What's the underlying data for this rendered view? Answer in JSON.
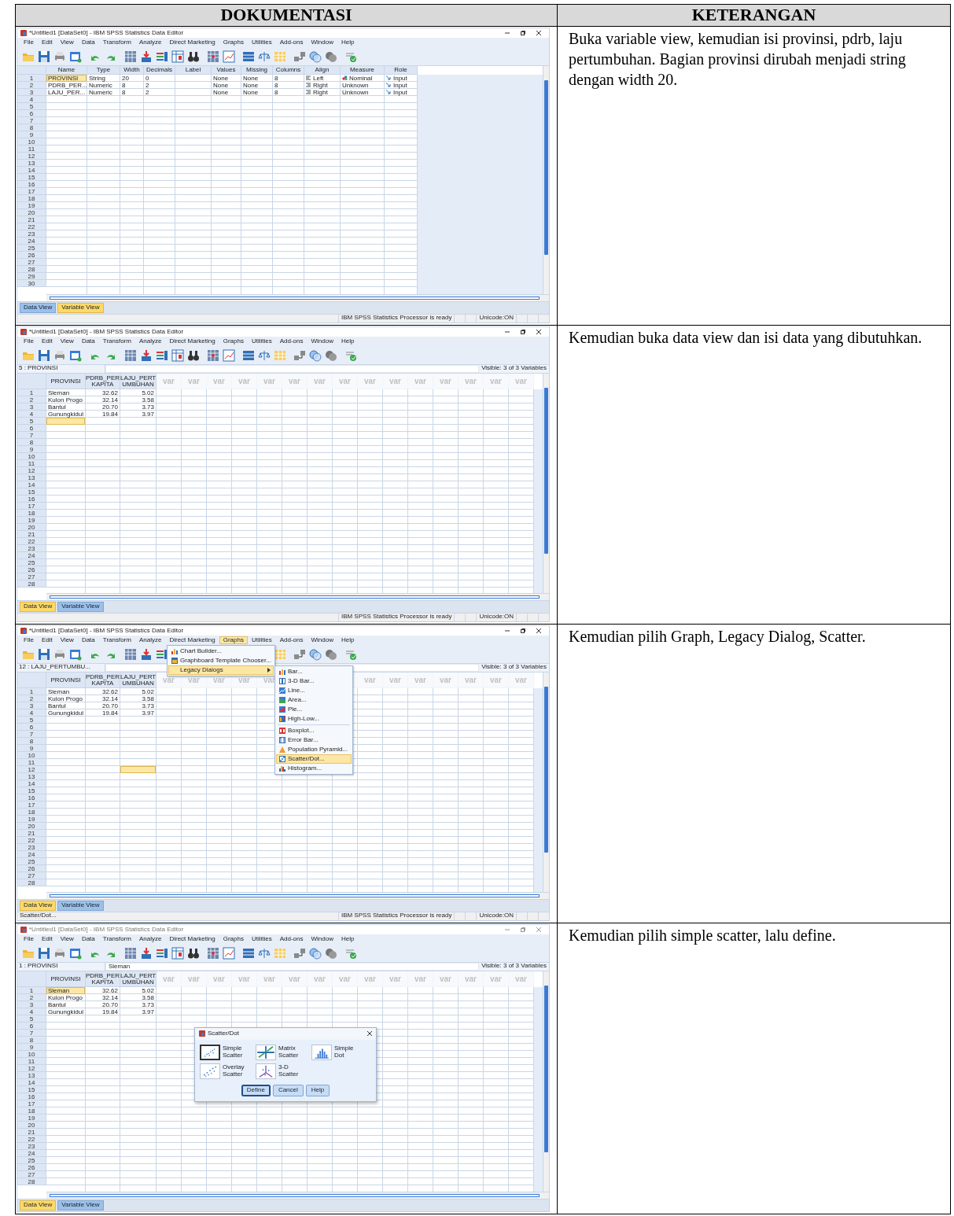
{
  "header": {
    "column_1": "DOKUMENTASI",
    "column_2": "KETERANGAN"
  },
  "steps": [
    {
      "description": "Buka variable view, kemudian isi provinsi, pdrb, laju pertumbuhan. Bagian provinsi dirubah menjadi string dengan width 20.",
      "window": {
        "title": "*Untitled1 [DataSet0] - IBM SPSS Statistics Data Editor",
        "active": true,
        "menu": [
          {
            "label": "File",
            "selected": false
          },
          {
            "label": "Edit",
            "selected": false
          },
          {
            "label": "View",
            "selected": false
          },
          {
            "label": "Data",
            "selected": false
          },
          {
            "label": "Transform",
            "selected": false
          },
          {
            "label": "Analyze",
            "selected": false
          },
          {
            "label": "Direct Marketing",
            "selected": false
          },
          {
            "label": "Graphs",
            "selected": false
          },
          {
            "label": "Utilities",
            "selected": false
          },
          {
            "label": "Add-ons",
            "selected": false
          },
          {
            "label": "Window",
            "selected": false
          },
          {
            "label": "Help",
            "selected": false
          }
        ],
        "grid": {
          "columns": [
            {
              "label": "Name",
              "kind": "property"
            },
            {
              "label": "Type",
              "kind": "property"
            },
            {
              "label": "Width",
              "kind": "property"
            },
            {
              "label": "Decimals",
              "kind": "property"
            },
            {
              "label": "Label",
              "kind": "property"
            },
            {
              "label": "Values",
              "kind": "property"
            },
            {
              "label": "Missing",
              "kind": "property"
            },
            {
              "label": "Columns",
              "kind": "property"
            },
            {
              "label": "Align",
              "kind": "property"
            },
            {
              "label": "Measure",
              "kind": "property"
            },
            {
              "label": "Role",
              "kind": "property"
            }
          ],
          "rows": [
            {
              "number": "1",
              "cells": [
                {
                  "text": "PROVINSI",
                  "selected": true
                },
                {
                  "text": "String",
                  "selected": false
                },
                {
                  "text": "20",
                  "selected": false
                },
                {
                  "text": "0",
                  "selected": false
                },
                {
                  "selected": false
                },
                {
                  "text": "None",
                  "selected": false
                },
                {
                  "text": "None",
                  "selected": false
                },
                {
                  "text": "8",
                  "selected": false
                },
                {
                  "text": "Left",
                  "selected": false,
                  "kind": "left"
                },
                {
                  "text": "Nominal",
                  "selected": false,
                  "kind": "nominal"
                },
                {
                  "text": "Input",
                  "selected": false,
                  "kind": "role"
                }
              ]
            },
            {
              "number": "2",
              "cells": [
                {
                  "text": "PDRB_PER...",
                  "selected": false
                },
                {
                  "text": "Numeric",
                  "selected": false
                },
                {
                  "text": "8",
                  "selected": false
                },
                {
                  "text": "2",
                  "selected": false
                },
                {
                  "selected": false
                },
                {
                  "text": "None",
                  "selected": false
                },
                {
                  "text": "None",
                  "selected": false
                },
                {
                  "text": "8",
                  "selected": false
                },
                {
                  "text": "Right",
                  "selected": false,
                  "kind": "right"
                },
                {
                  "text": "Unknown",
                  "selected": false
                },
                {
                  "text": "Input",
                  "selected": false,
                  "kind": "role"
                }
              ]
            },
            {
              "number": "3",
              "cells": [
                {
                  "text": "LAJU_PER...",
                  "selected": false
                },
                {
                  "text": "Numeric",
                  "selected": false
                },
                {
                  "text": "8",
                  "selected": false
                },
                {
                  "text": "2",
                  "selected": false
                },
                {
                  "selected": false
                },
                {
                  "text": "None",
                  "selected": false
                },
                {
                  "text": "None",
                  "selected": false
                },
                {
                  "text": "8",
                  "selected": false
                },
                {
                  "text": "Right",
                  "selected": false,
                  "kind": "right"
                },
                {
                  "text": "Unknown",
                  "selected": false
                },
                {
                  "text": "Input",
                  "selected": false,
                  "kind": "role"
                }
              ]
            },
            {
              "number": "4"
            },
            {
              "number": "5"
            },
            {
              "number": "6"
            },
            {
              "number": "7"
            },
            {
              "number": "8"
            },
            {
              "number": "9"
            },
            {
              "number": "10"
            },
            {
              "number": "11"
            },
            {
              "number": "12"
            },
            {
              "number": "13"
            },
            {
              "number": "14"
            },
            {
              "number": "15"
            },
            {
              "number": "16"
            },
            {
              "number": "17"
            },
            {
              "number": "18"
            },
            {
              "number": "19"
            },
            {
              "number": "20"
            },
            {
              "number": "21"
            },
            {
              "number": "22"
            },
            {
              "number": "23"
            },
            {
              "number": "24"
            },
            {
              "number": "25"
            },
            {
              "number": "26"
            },
            {
              "number": "27"
            },
            {
              "number": "28"
            },
            {
              "number": "29"
            },
            {
              "number": "30"
            }
          ]
        },
        "tabs": [
          {
            "label": "Data View",
            "selected": false
          },
          {
            "label": "Variable View",
            "selected": true
          }
        ],
        "status": {
          "processor": "IBM SPSS Statistics Processor is ready",
          "unicode": "Unicode:ON"
        }
      }
    },
    {
      "description": "Kemudian buka data view dan isi data yang dibutuhkan.",
      "window": {
        "title": "*Untitled1 [DataSet0] - IBM SPSS Statistics Data Editor",
        "active": true,
        "menu": [
          {
            "label": "File",
            "selected": false
          },
          {
            "label": "Edit",
            "selected": false
          },
          {
            "label": "View",
            "selected": false
          },
          {
            "label": "Data",
            "selected": false
          },
          {
            "label": "Transform",
            "selected": false
          },
          {
            "label": "Analyze",
            "selected": false
          },
          {
            "label": "Direct Marketing",
            "selected": false
          },
          {
            "label": "Graphs",
            "selected": false
          },
          {
            "label": "Utilities",
            "selected": false
          },
          {
            "label": "Add-ons",
            "selected": false
          },
          {
            "label": "Window",
            "selected": false
          },
          {
            "label": "Help",
            "selected": false
          }
        ],
        "cell_editor": {
          "reference": "5 : PROVINSI"
        },
        "visible_label": "Visible: 3 of 3 Variables",
        "grid": {
          "columns": [
            {
              "label": "PROVINSI",
              "kind": "string"
            },
            {
              "label": "PDRB_PER KAPITA",
              "kind": "numeric"
            },
            {
              "label": "LAJU_PERT UMBUHAN",
              "kind": "numeric"
            },
            {
              "label": "var",
              "kind": "empty"
            },
            {
              "label": "var",
              "kind": "empty"
            },
            {
              "label": "var",
              "kind": "empty"
            },
            {
              "label": "var",
              "kind": "empty"
            },
            {
              "label": "var",
              "kind": "empty"
            },
            {
              "label": "var",
              "kind": "empty"
            },
            {
              "label": "var",
              "kind": "empty"
            },
            {
              "label": "var",
              "kind": "empty"
            },
            {
              "label": "var",
              "kind": "empty"
            },
            {
              "label": "var",
              "kind": "empty"
            },
            {
              "label": "var",
              "kind": "empty"
            },
            {
              "label": "var",
              "kind": "empty"
            },
            {
              "label": "var",
              "kind": "empty"
            },
            {
              "label": "var",
              "kind": "empty"
            },
            {
              "label": "var",
              "kind": "empty"
            }
          ],
          "rows": [
            {
              "number": "1",
              "cells": [
                {
                  "text": "Sleman",
                  "selected": false
                },
                {
                  "text": "32.62",
                  "selected": false
                },
                {
                  "text": "5.02",
                  "selected": false
                }
              ]
            },
            {
              "number": "2",
              "cells": [
                {
                  "text": "Kulon Progo",
                  "selected": false
                },
                {
                  "text": "32.14",
                  "selected": false
                },
                {
                  "text": "3.58",
                  "selected": false
                }
              ]
            },
            {
              "number": "3",
              "cells": [
                {
                  "text": "Bantul",
                  "selected": false
                },
                {
                  "text": "20.70",
                  "selected": false
                },
                {
                  "text": "3.73",
                  "selected": false
                }
              ]
            },
            {
              "number": "4",
              "cells": [
                {
                  "text": "Gunungkidul",
                  "selected": false
                },
                {
                  "text": "19.84",
                  "selected": false
                },
                {
                  "text": "3.97",
                  "selected": false
                }
              ]
            },
            {
              "number": "5",
              "cells": [
                {
                  "selected": true
                }
              ]
            },
            {
              "number": "6"
            },
            {
              "number": "7"
            },
            {
              "number": "8"
            },
            {
              "number": "9"
            },
            {
              "number": "10"
            },
            {
              "number": "11"
            },
            {
              "number": "12"
            },
            {
              "number": "13"
            },
            {
              "number": "14"
            },
            {
              "number": "15"
            },
            {
              "number": "16"
            },
            {
              "number": "17"
            },
            {
              "number": "18"
            },
            {
              "number": "19"
            },
            {
              "number": "20"
            },
            {
              "number": "21"
            },
            {
              "number": "22"
            },
            {
              "number": "23"
            },
            {
              "number": "24"
            },
            {
              "number": "25"
            },
            {
              "number": "26"
            },
            {
              "number": "27"
            },
            {
              "number": "28"
            }
          ]
        },
        "tabs": [
          {
            "label": "Data View",
            "selected": true
          },
          {
            "label": "Variable View",
            "selected": false
          }
        ],
        "status": {
          "processor": "IBM SPSS Statistics Processor is ready",
          "unicode": "Unicode:ON"
        }
      }
    },
    {
      "description": "Kemudian pilih Graph, Legacy Dialog, Scatter.",
      "window": {
        "title": "*Untitled1 [DataSet0] - IBM SPSS Statistics Data Editor",
        "active": true,
        "menu": [
          {
            "label": "File",
            "selected": false
          },
          {
            "label": "Edit",
            "selected": false
          },
          {
            "label": "View",
            "selected": false
          },
          {
            "label": "Data",
            "selected": false
          },
          {
            "label": "Transform",
            "selected": false
          },
          {
            "label": "Analyze",
            "selected": false
          },
          {
            "label": "Direct Marketing",
            "selected": false
          },
          {
            "label": "Graphs",
            "selected": true
          },
          {
            "label": "Utilities",
            "selected": false
          },
          {
            "label": "Add-ons",
            "selected": false
          },
          {
            "label": "Window",
            "selected": false
          },
          {
            "label": "Help",
            "selected": false
          }
        ],
        "dropdown": [
          {
            "label": "Chart Builder...",
            "kind": "builder",
            "selected": false,
            "submenu": false
          },
          {
            "label": "Graphboard Template Chooser...",
            "kind": "graphboard",
            "selected": false,
            "submenu": false
          },
          {
            "label": "Legacy Dialogs",
            "kind": "legacy",
            "selected": true,
            "submenu": true
          }
        ],
        "submenu": [
          {
            "kind": "bar",
            "label": "Bar...",
            "selected": false
          },
          {
            "kind": "bar3d",
            "label": "3-D Bar...",
            "selected": false
          },
          {
            "kind": "line",
            "label": "Line...",
            "selected": false
          },
          {
            "kind": "area",
            "label": "Area...",
            "selected": false
          },
          {
            "kind": "pie",
            "label": "Pie...",
            "selected": false
          },
          {
            "kind": "highlow",
            "label": "High-Low...",
            "selected": false
          },
          {
            "kind": "separator"
          },
          {
            "kind": "boxplot",
            "label": "Boxplot...",
            "selected": false
          },
          {
            "kind": "errorbar",
            "label": "Error Bar...",
            "selected": false
          },
          {
            "kind": "pyramid",
            "label": "Population Pyramid...",
            "selected": false
          },
          {
            "kind": "scatter",
            "label": "Scatter/Dot...",
            "selected": true
          },
          {
            "kind": "histogram",
            "label": "Histogram...",
            "selected": false
          }
        ],
        "cell_editor": {
          "reference": "12 : LAJU_PERTUMBU..."
        },
        "visible_label": "Visible: 3 of 3 Variables",
        "grid": {
          "columns": [
            {
              "label": "PROVINSI",
              "kind": "string"
            },
            {
              "label": "PDRB_PER KAPITA",
              "kind": "numeric"
            },
            {
              "label": "LAJU_PERT UMBUHAN",
              "kind": "numeric"
            },
            {
              "label": "var",
              "kind": "empty"
            },
            {
              "label": "var",
              "kind": "empty"
            },
            {
              "label": "var",
              "kind": "empty"
            },
            {
              "label": "var",
              "kind": "empty"
            },
            {
              "label": "var",
              "kind": "empty"
            },
            {
              "kind": "empty"
            },
            {
              "kind": "empty"
            },
            {
              "kind": "empty"
            },
            {
              "label": "var",
              "kind": "empty"
            },
            {
              "label": "var",
              "kind": "empty"
            },
            {
              "label": "var",
              "kind": "empty"
            },
            {
              "label": "var",
              "kind": "empty"
            },
            {
              "label": "var",
              "kind": "empty"
            },
            {
              "label": "var",
              "kind": "empty"
            },
            {
              "label": "var",
              "kind": "empty"
            }
          ],
          "rows": [
            {
              "number": "1",
              "cells": [
                {
                  "text": "Sleman",
                  "selected": false
                },
                {
                  "text": "32.62",
                  "selected": false
                },
                {
                  "text": "5.02",
                  "selected": false
                }
              ]
            },
            {
              "number": "2",
              "cells": [
                {
                  "text": "Kulon Progo",
                  "selected": false
                },
                {
                  "text": "32.14",
                  "selected": false
                },
                {
                  "text": "3.58",
                  "selected": false
                }
              ]
            },
            {
              "number": "3",
              "cells": [
                {
                  "text": "Bantul",
                  "selected": false
                },
                {
                  "text": "20.70",
                  "selected": false
                },
                {
                  "text": "3.73",
                  "selected": false
                }
              ]
            },
            {
              "number": "4",
              "cells": [
                {
                  "text": "Gunungkidul",
                  "selected": false
                },
                {
                  "text": "19.84",
                  "selected": false
                },
                {
                  "text": "3.97",
                  "selected": false
                }
              ]
            },
            {
              "number": "5"
            },
            {
              "number": "6"
            },
            {
              "number": "7"
            },
            {
              "number": "8"
            },
            {
              "number": "9"
            },
            {
              "number": "10"
            },
            {
              "number": "11"
            },
            {
              "number": "12",
              "cells": [
                {
                  "selected": false
                },
                {
                  "selected": false
                },
                {
                  "selected": true
                }
              ]
            },
            {
              "number": "13"
            },
            {
              "number": "14"
            },
            {
              "number": "15"
            },
            {
              "number": "16"
            },
            {
              "number": "17"
            },
            {
              "number": "18"
            },
            {
              "number": "19"
            },
            {
              "number": "20"
            },
            {
              "number": "21"
            },
            {
              "number": "22"
            },
            {
              "number": "23"
            },
            {
              "number": "24"
            },
            {
              "number": "25"
            },
            {
              "number": "26"
            },
            {
              "number": "27"
            },
            {
              "number": "28"
            }
          ]
        },
        "tabs": [
          {
            "label": "Data View",
            "selected": true
          },
          {
            "label": "Variable View",
            "selected": false
          }
        ],
        "status": {
          "message": "Scatter/Dot...",
          "processor": "IBM SPSS Statistics Processor is ready",
          "unicode": "Unicode:ON"
        }
      }
    },
    {
      "description": "Kemudian pilih simple scatter, lalu define.",
      "window": {
        "title": "*Untitled1 [DataSet0] - IBM SPSS Statistics Data Editor",
        "active": false,
        "menu": [
          {
            "label": "File",
            "selected": false
          },
          {
            "label": "Edit",
            "selected": false
          },
          {
            "label": "View",
            "selected": false
          },
          {
            "label": "Data",
            "selected": false
          },
          {
            "label": "Transform",
            "selected": false
          },
          {
            "label": "Analyze",
            "selected": false
          },
          {
            "label": "Direct Marketing",
            "selected": false
          },
          {
            "label": "Graphs",
            "selected": false
          },
          {
            "label": "Utilities",
            "selected": false
          },
          {
            "label": "Add-ons",
            "selected": false
          },
          {
            "label": "Window",
            "selected": false
          },
          {
            "label": "Help",
            "selected": false
          }
        ],
        "cell_editor": {
          "reference": "1 : PROVINSI",
          "value": "Sleman"
        },
        "visible_label": "Visible: 3 of 3 Variables",
        "grid": {
          "columns": [
            {
              "label": "PROVINSI",
              "kind": "string"
            },
            {
              "label": "PDRB_PER KAPITA",
              "kind": "numeric"
            },
            {
              "label": "LAJU_PERT UMBUHAN",
              "kind": "numeric"
            },
            {
              "label": "var",
              "kind": "empty"
            },
            {
              "label": "var",
              "kind": "empty"
            },
            {
              "label": "var",
              "kind": "empty"
            },
            {
              "label": "var",
              "kind": "empty"
            },
            {
              "label": "var",
              "kind": "empty"
            },
            {
              "label": "var",
              "kind": "empty"
            },
            {
              "label": "var",
              "kind": "empty"
            },
            {
              "label": "var",
              "kind": "empty"
            },
            {
              "label": "var",
              "kind": "empty"
            },
            {
              "label": "var",
              "kind": "empty"
            },
            {
              "label": "var",
              "kind": "empty"
            },
            {
              "label": "var",
              "kind": "empty"
            },
            {
              "label": "var",
              "kind": "empty"
            },
            {
              "label": "var",
              "kind": "empty"
            },
            {
              "label": "var",
              "kind": "empty"
            }
          ],
          "rows": [
            {
              "number": "1",
              "cells": [
                {
                  "text": "Sleman",
                  "selected": true
                },
                {
                  "text": "32.62",
                  "selected": false
                },
                {
                  "text": "5.02",
                  "selected": false
                }
              ]
            },
            {
              "number": "2",
              "cells": [
                {
                  "text": "Kulon Progo",
                  "selected": false
                },
                {
                  "text": "32.14",
                  "selected": false
                },
                {
                  "text": "3.58",
                  "selected": false
                }
              ]
            },
            {
              "number": "3",
              "cells": [
                {
                  "text": "Bantul",
                  "selected": false
                },
                {
                  "text": "20.70",
                  "selected": false
                },
                {
                  "text": "3.73",
                  "selected": false
                }
              ]
            },
            {
              "number": "4",
              "cells": [
                {
                  "text": "Gunungkidul",
                  "selected": false
                },
                {
                  "text": "19.84",
                  "selected": false
                },
                {
                  "text": "3.97",
                  "selected": false
                }
              ]
            },
            {
              "number": "5"
            },
            {
              "number": "6"
            },
            {
              "number": "7"
            },
            {
              "number": "8"
            },
            {
              "number": "9"
            },
            {
              "number": "10"
            },
            {
              "number": "11"
            },
            {
              "number": "12"
            },
            {
              "number": "13"
            },
            {
              "number": "14"
            },
            {
              "number": "15"
            },
            {
              "number": "16"
            },
            {
              "number": "17"
            },
            {
              "number": "18"
            },
            {
              "number": "19"
            },
            {
              "number": "20"
            },
            {
              "number": "21"
            },
            {
              "number": "22"
            },
            {
              "number": "23"
            },
            {
              "number": "24"
            },
            {
              "number": "25"
            },
            {
              "number": "26"
            },
            {
              "number": "27"
            },
            {
              "number": "28"
            }
          ]
        },
        "tabs": [
          {
            "label": "Data View",
            "selected": true
          },
          {
            "label": "Variable View",
            "selected": false
          }
        ],
        "dialog": {
          "title": "Scatter/Dot",
          "options": [
            {
              "label": "Simple Scatter",
              "kind": "simple",
              "selected": true
            },
            {
              "label": "Matrix Scatter",
              "kind": "matrix",
              "selected": false
            },
            {
              "label": "Simple Dot",
              "kind": "dot",
              "selected": false
            },
            {
              "label": "Overlay Scatter",
              "kind": "overlay",
              "selected": false
            },
            {
              "label": "3-D Scatter",
              "kind": "threed",
              "selected": false
            }
          ],
          "buttons": [
            {
              "label": "Define",
              "default": true
            },
            {
              "label": "Cancel",
              "default": false
            },
            {
              "label": "Help",
              "default": false
            }
          ]
        }
      }
    }
  ]
}
